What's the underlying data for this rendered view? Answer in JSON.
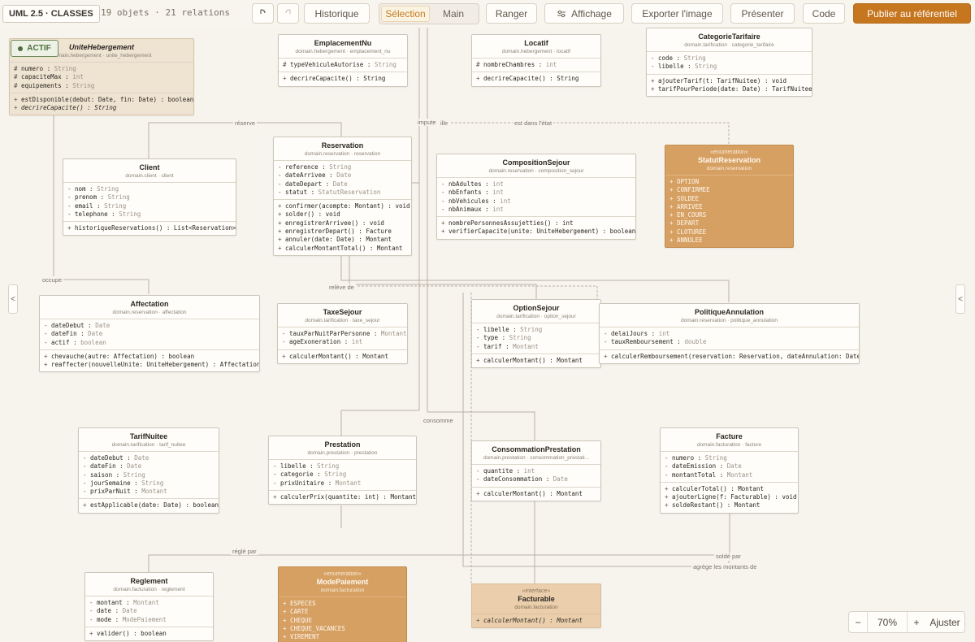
{
  "toolbar": {
    "badge": "UML 2.5 · CLASSES",
    "counts": "19 objets · 21 relations",
    "undo_icon": "undo-icon",
    "redo_icon": "redo-icon",
    "historique": "Historique",
    "selection": "Sélection",
    "main": "Main",
    "ranger": "Ranger",
    "affichage": "Affichage",
    "exporter": "Exporter l'image",
    "presenter": "Présenter",
    "code": "Code",
    "publier": "Publier au référentiel"
  },
  "status_badge": "ACTIF",
  "side": {
    "left": "<",
    "right": "<"
  },
  "zoom": {
    "minus": "−",
    "value": "70%",
    "plus": "+",
    "fit": "Ajuster"
  },
  "colors": {
    "accent": "#c5761f",
    "enum": "#d6a063",
    "interface": "#ebcfac",
    "selected": "#efe3d1",
    "active": "#4d6e3c"
  },
  "classes": {
    "unite": {
      "name": "UniteHebergement",
      "pkg": "domain.hebergement · unite_hebergement",
      "attrs": [
        {
          "v": "#",
          "n": "numero",
          "t": "String"
        },
        {
          "v": "#",
          "n": "capaciteMax",
          "t": "int"
        },
        {
          "v": "#",
          "n": "equipements",
          "t": "String"
        }
      ],
      "ops": [
        {
          "v": "+",
          "n": "estDisponible(debut: Date, fin: Date) : boolean"
        },
        {
          "v": "+",
          "n": "decrireCapacite() : String",
          "i": true
        }
      ]
    },
    "emplacement": {
      "name": "EmplacementNu",
      "pkg": "domain.hebergement · emplacement_nu",
      "attrs": [
        {
          "v": "#",
          "n": "typeVehiculeAutorise",
          "t": "String"
        }
      ],
      "ops": [
        {
          "v": "+",
          "n": "decrireCapacite() : String"
        }
      ]
    },
    "locatif": {
      "name": "Locatif",
      "pkg": "domain.hebergement · locatif",
      "attrs": [
        {
          "v": "#",
          "n": "nombreChambres",
          "t": "int"
        }
      ],
      "ops": [
        {
          "v": "+",
          "n": "decrireCapacite() : String"
        }
      ]
    },
    "categorie": {
      "name": "CategorieTarifaire",
      "pkg": "domain.tarification · categorie_tarifaire",
      "attrs": [
        {
          "v": "-",
          "n": "code",
          "t": "String"
        },
        {
          "v": "-",
          "n": "libelle",
          "t": "String"
        }
      ],
      "ops": [
        {
          "v": "+",
          "n": "ajouterTarif(t: TarifNuitee) : void"
        },
        {
          "v": "+",
          "n": "tarifPourPeriode(date: Date) : TarifNuitee"
        }
      ]
    },
    "client": {
      "name": "Client",
      "pkg": "domain.client · client",
      "attrs": [
        {
          "v": "-",
          "n": "nom",
          "t": "String"
        },
        {
          "v": "-",
          "n": "prenom",
          "t": "String"
        },
        {
          "v": "-",
          "n": "email",
          "t": "String"
        },
        {
          "v": "-",
          "n": "telephone",
          "t": "String"
        }
      ],
      "ops": [
        {
          "v": "+",
          "n": "historiqueReservations() : List<Reservation>"
        }
      ]
    },
    "reservation": {
      "name": "Reservation",
      "pkg": "domain.reservation · reservation",
      "attrs": [
        {
          "v": "-",
          "n": "reference",
          "t": "String"
        },
        {
          "v": "-",
          "n": "dateArrivee",
          "t": "Date"
        },
        {
          "v": "-",
          "n": "dateDepart",
          "t": "Date"
        },
        {
          "v": "-",
          "n": "statut",
          "t": "StatutReservation"
        }
      ],
      "ops": [
        {
          "v": "+",
          "n": "confirmer(acompte: Montant) : void"
        },
        {
          "v": "+",
          "n": "solder() : void"
        },
        {
          "v": "+",
          "n": "enregistrerArrivee() : void"
        },
        {
          "v": "+",
          "n": "enregistrerDepart() : Facture"
        },
        {
          "v": "+",
          "n": "annuler(date: Date) : Montant"
        },
        {
          "v": "+",
          "n": "calculerMontantTotal() : Montant"
        }
      ]
    },
    "composition": {
      "name": "CompositionSejour",
      "pkg": "domain.reservation · composition_sejour",
      "attrs": [
        {
          "v": "-",
          "n": "nbAdultes",
          "t": "int"
        },
        {
          "v": "-",
          "n": "nbEnfants",
          "t": "int"
        },
        {
          "v": "-",
          "n": "nbVehicules",
          "t": "int"
        },
        {
          "v": "-",
          "n": "nbAnimaux",
          "t": "int"
        }
      ],
      "ops": [
        {
          "v": "+",
          "n": "nombrePersonnesAssujetties() : int"
        },
        {
          "v": "+",
          "n": "verifierCapacite(unite: UniteHebergement) : boolean"
        }
      ]
    },
    "statut": {
      "stereo": "«enumeration»",
      "name": "StatutReservation",
      "pkg": "domain.reservation",
      "literals": [
        "OPTION",
        "CONFIRMEE",
        "SOLDEE",
        "ARRIVEE",
        "EN_COURS",
        "DEPART",
        "CLOTUREE",
        "ANNULEE"
      ]
    },
    "affectation": {
      "name": "Affectation",
      "pkg": "domain.reservation · affectation",
      "attrs": [
        {
          "v": "-",
          "n": "dateDebut",
          "t": "Date"
        },
        {
          "v": "-",
          "n": "dateFin",
          "t": "Date"
        },
        {
          "v": "-",
          "n": "actif",
          "t": "boolean"
        }
      ],
      "ops": [
        {
          "v": "+",
          "n": "chevauche(autre: Affectation) : boolean"
        },
        {
          "v": "+",
          "n": "reaffecter(nouvelleUnite: UniteHebergement) : Affectation"
        }
      ]
    },
    "taxe": {
      "name": "TaxeSejour",
      "pkg": "domain.tarification · taxe_sejour",
      "attrs": [
        {
          "v": "-",
          "n": "tauxParNuitParPersonne",
          "t": "Montant"
        },
        {
          "v": "-",
          "n": "ageExoneration",
          "t": "int"
        }
      ],
      "ops": [
        {
          "v": "+",
          "n": "calculerMontant() : Montant"
        }
      ]
    },
    "option": {
      "name": "OptionSejour",
      "pkg": "domain.tarification · option_sejour",
      "attrs": [
        {
          "v": "-",
          "n": "libelle",
          "t": "String"
        },
        {
          "v": "-",
          "n": "type",
          "t": "String"
        },
        {
          "v": "-",
          "n": "tarif",
          "t": "Montant"
        }
      ],
      "ops": [
        {
          "v": "+",
          "n": "calculerMontant() : Montant"
        }
      ]
    },
    "politique": {
      "name": "PolitiqueAnnulation",
      "pkg": "domain.reservation · politique_annulation",
      "attrs": [
        {
          "v": "-",
          "n": "delaiJours",
          "t": "int"
        },
        {
          "v": "-",
          "n": "tauxRemboursement",
          "t": "double"
        }
      ],
      "ops": [
        {
          "v": "+",
          "n": "calculerRemboursement(reservation: Reservation, dateAnnulation: Date) : Montant"
        }
      ]
    },
    "tarif": {
      "name": "TarifNuitee",
      "pkg": "domain.tarification · tarif_nuitee",
      "attrs": [
        {
          "v": "-",
          "n": "dateDebut",
          "t": "Date"
        },
        {
          "v": "-",
          "n": "dateFin",
          "t": "Date"
        },
        {
          "v": "-",
          "n": "saison",
          "t": "String"
        },
        {
          "v": "-",
          "n": "jourSemaine",
          "t": "String"
        },
        {
          "v": "-",
          "n": "prixParNuit",
          "t": "Montant"
        }
      ],
      "ops": [
        {
          "v": "+",
          "n": "estApplicable(date: Date) : boolean"
        }
      ]
    },
    "prestation": {
      "name": "Prestation",
      "pkg": "domain.prestation · prestation",
      "attrs": [
        {
          "v": "-",
          "n": "libelle",
          "t": "String"
        },
        {
          "v": "-",
          "n": "categorie",
          "t": "String"
        },
        {
          "v": "-",
          "n": "prixUnitaire",
          "t": "Montant"
        }
      ],
      "ops": [
        {
          "v": "+",
          "n": "calculerPrix(quantite: int) : Montant"
        }
      ]
    },
    "consommation": {
      "name": "ConsommationPrestation",
      "pkg": "domain.prestation · consommation_prestati...",
      "attrs": [
        {
          "v": "-",
          "n": "quantite",
          "t": "int"
        },
        {
          "v": "-",
          "n": "dateConsommation",
          "t": "Date"
        }
      ],
      "ops": [
        {
          "v": "+",
          "n": "calculerMontant() : Montant"
        }
      ]
    },
    "facture": {
      "name": "Facture",
      "pkg": "domain.facturation · facture",
      "attrs": [
        {
          "v": "-",
          "n": "numero",
          "t": "String"
        },
        {
          "v": "-",
          "n": "dateEmission",
          "t": "Date"
        },
        {
          "v": "-",
          "n": "montantTotal",
          "t": "Montant"
        }
      ],
      "ops": [
        {
          "v": "+",
          "n": "calculerTotal() : Montant"
        },
        {
          "v": "+",
          "n": "ajouterLigne(f: Facturable) : void"
        },
        {
          "v": "+",
          "n": "soldeRestant() : Montant"
        }
      ]
    },
    "reglement": {
      "name": "Reglement",
      "pkg": "domain.facturation · reglement",
      "attrs": [
        {
          "v": "-",
          "n": "montant",
          "t": "Montant"
        },
        {
          "v": "-",
          "n": "date",
          "t": "Date"
        },
        {
          "v": "-",
          "n": "mode",
          "t": "ModePaiement"
        }
      ],
      "ops": [
        {
          "v": "+",
          "n": "valider() : boolean"
        }
      ]
    },
    "mode": {
      "stereo": "«enumeration»",
      "name": "ModePaiement",
      "pkg": "domain.facturation",
      "literals": [
        "ESPECES",
        "CARTE",
        "CHEQUE",
        "CHEQUE_VACANCES",
        "VIREMENT"
      ]
    },
    "facturable": {
      "stereo": "«interface»",
      "name": "Facturable",
      "pkg": "domain.facturation",
      "ops": [
        {
          "v": "+",
          "n": "calculerMontant() : Montant",
          "i": true
        }
      ]
    }
  },
  "edge_labels": {
    "reserve": "réserve",
    "impute": "impute",
    "ille": "ille",
    "etat": "est dans l'état",
    "occupe": "occupe",
    "releve": "relève de",
    "consomme": "consomme",
    "regle": "réglé par",
    "solde": "soldé par",
    "agrege": "agrège les montants de"
  }
}
